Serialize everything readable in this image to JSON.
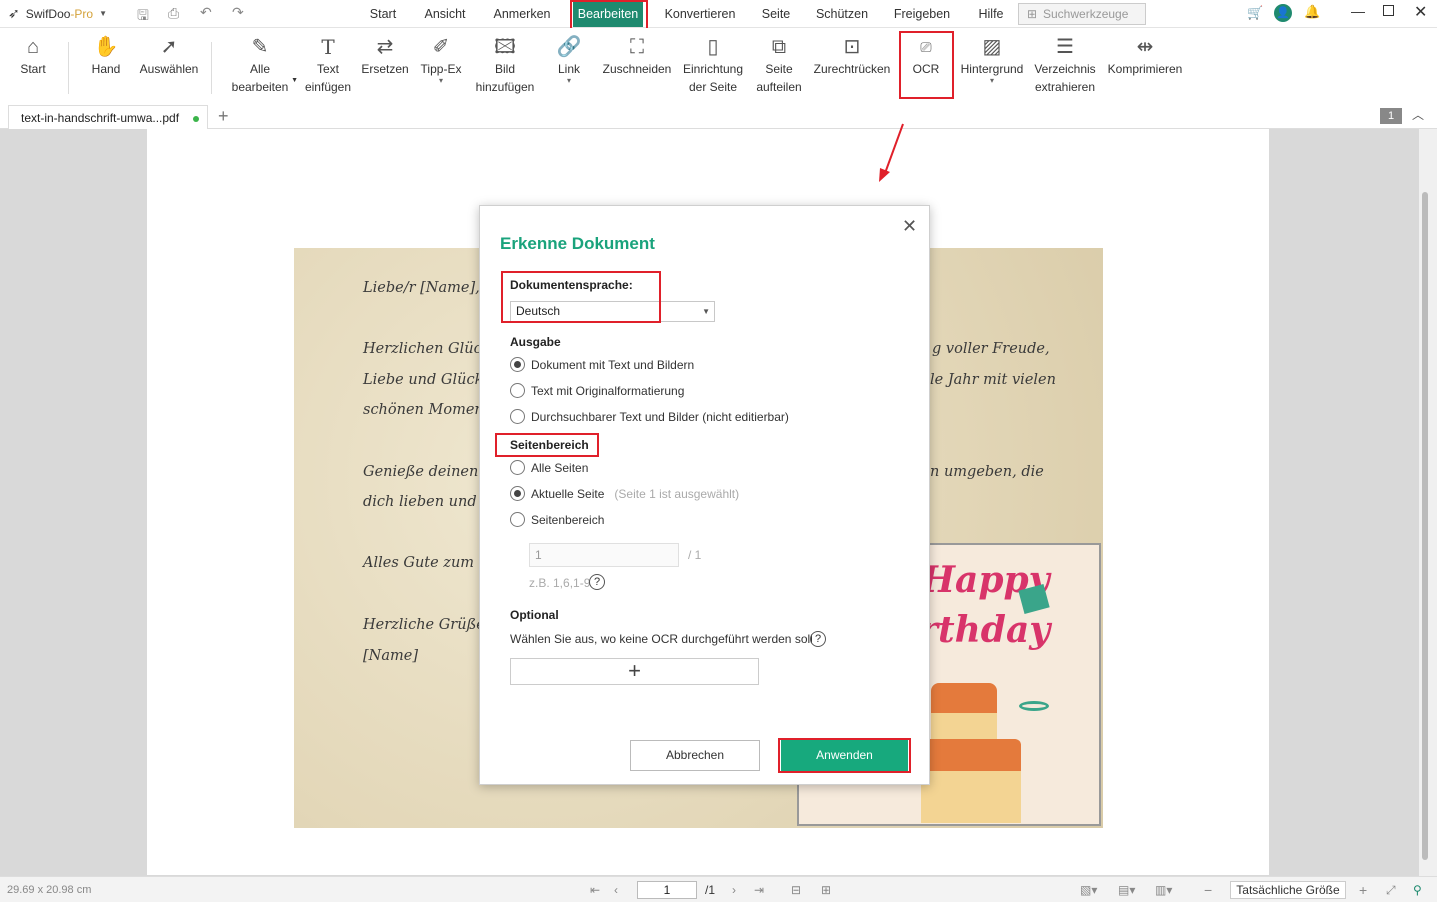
{
  "app": {
    "name": "SwifDoo",
    "suffix": "-Pro"
  },
  "menu": [
    "Start",
    "Ansicht",
    "Anmerken",
    "Bearbeiten",
    "Konvertieren",
    "Seite",
    "Schützen",
    "Freigeben",
    "Hilfe"
  ],
  "search_placeholder": "Suchwerkzeuge",
  "toolbar": {
    "start": "Start",
    "hand": "Hand",
    "select": "Auswählen",
    "edit_all_1": "Alle",
    "edit_all_2": "bearbeiten",
    "insert_text_1": "Text",
    "insert_text_2": "einfügen",
    "replace": "Ersetzen",
    "whiteout": "Tipp-Ex",
    "add_image_1": "Bild",
    "add_image_2": "hinzufügen",
    "link": "Link",
    "crop": "Zuschneiden",
    "page_setup_1": "Einrichtung",
    "page_setup_2": "der Seite",
    "split_1": "Seite",
    "split_2": "aufteilen",
    "straighten": "Zurechtrücken",
    "ocr": "OCR",
    "background": "Hintergrund",
    "extract_1": "Verzeichnis",
    "extract_2": "extrahieren",
    "compress": "Komprimieren"
  },
  "tab": {
    "filename": "text-in-handschrift-umwa...pdf",
    "page_badge": "1"
  },
  "letter": {
    "l1": "Liebe/r [Name],",
    "l2a": "Herzlichen Glück",
    "l2b": "g voller Freude,",
    "l3a": "Liebe und Glück.",
    "l3b": "le Jahr mit vielen",
    "l4": "schönen Moment",
    "l5a": "Genieße deinen",
    "l5b": "n umgeben, die",
    "l6": "dich lieben und",
    "l7": "Alles Gute zum",
    "l8": "Herzliche Grüße,",
    "l9": "[Name]",
    "card_1": "Happy",
    "card_2": "rthday"
  },
  "dialog": {
    "title": "Erkenne Dokument",
    "language_label": "Dokumentensprache:",
    "language_value": "Deutsch",
    "output_label": "Ausgabe",
    "output_options": [
      "Dokument mit Text und Bildern",
      "Text mit Originalformatierung",
      "Durchsuchbarer Text und Bilder (nicht editierbar)"
    ],
    "range_label": "Seitenbereich",
    "range_options": [
      "Alle Seiten",
      "Aktuelle Seite",
      "Seitenbereich"
    ],
    "current_page_hint": "(Seite 1 ist ausgewählt)",
    "range_value": "1",
    "range_total": "/ 1",
    "range_example": "z.B. 1,6,1-9",
    "optional_label": "Optional",
    "optional_desc": "Wählen Sie aus, wo keine OCR durchgeführt werden soll",
    "add_symbol": "+",
    "cancel": "Abbrechen",
    "apply": "Anwenden"
  },
  "status": {
    "page_size": "29.69 x 20.98 cm",
    "page_input": "1",
    "page_total": "/1",
    "fit": "Tatsächliche Größe"
  },
  "colors": {
    "accent": "#1f8a6f",
    "apply": "#17a97d",
    "title": "#1aa37c",
    "highlight": "#e0202a"
  }
}
